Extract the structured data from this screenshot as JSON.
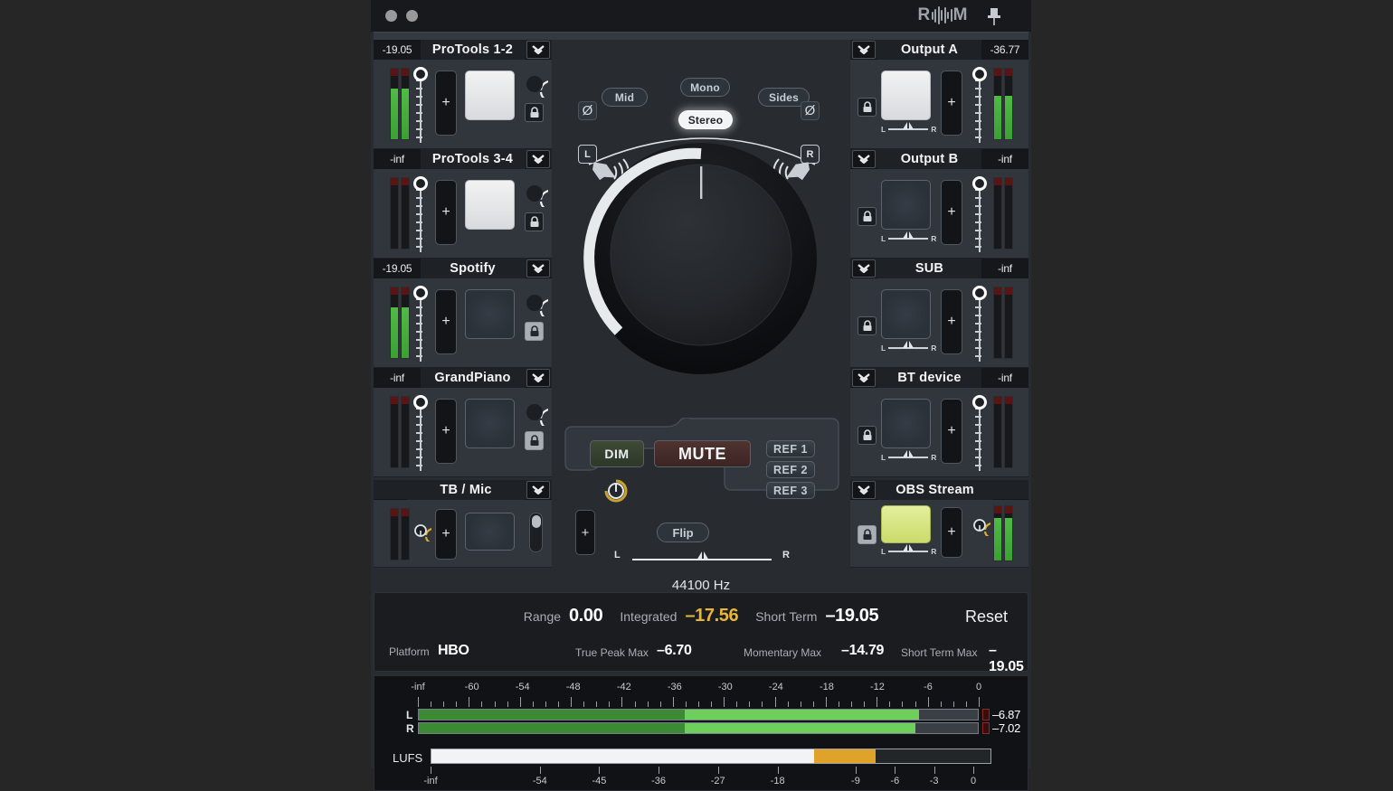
{
  "window": {
    "logo_text_left": "R",
    "logo_text_right": "M",
    "pin_icon": "pushpin-icon",
    "close_dot": "window-dot",
    "min_dot": "window-dot"
  },
  "inputs": [
    {
      "value": "-19.05",
      "name": "ProTools 1-2",
      "meter_pct": 72,
      "pad_state": "lit",
      "fader_pct": 100,
      "lock": "unlocked",
      "plus": "+"
    },
    {
      "value": "-inf",
      "name": "ProTools 3-4",
      "meter_pct": 0,
      "pad_state": "lit",
      "fader_pct": 100,
      "lock": "unlocked",
      "plus": "+"
    },
    {
      "value": "-19.05",
      "name": "Spotify",
      "meter_pct": 72,
      "pad_state": "dark",
      "fader_pct": 100,
      "lock": "locked",
      "plus": "+"
    },
    {
      "value": "-inf",
      "name": "GrandPiano",
      "meter_pct": 0,
      "pad_state": "dark",
      "fader_pct": 100,
      "lock": "locked",
      "plus": "+"
    }
  ],
  "talkback": {
    "name": "TB / Mic",
    "plus": "+",
    "mic_icon": "mic-knob-icon",
    "slider_icon": "vertical-slider"
  },
  "outputs": [
    {
      "name": "Output A",
      "value": "-36.77",
      "meter_pct": 62,
      "pad_state": "lit",
      "lock": "unlocked",
      "plus": "+",
      "pan_l": "L",
      "pan_r": "R"
    },
    {
      "name": "Output B",
      "value": "-inf",
      "meter_pct": 0,
      "pad_state": "dark",
      "lock": "unlocked",
      "plus": "+",
      "pan_l": "L",
      "pan_r": "R"
    },
    {
      "name": "SUB",
      "value": "-inf",
      "meter_pct": 0,
      "pad_state": "dark",
      "lock": "unlocked",
      "plus": "+",
      "pan_l": "L",
      "pan_r": "R"
    },
    {
      "name": "BT device",
      "value": "-inf",
      "meter_pct": 0,
      "pad_state": "dark",
      "lock": "unlocked",
      "plus": "+",
      "pan_l": "L",
      "pan_r": "R"
    }
  ],
  "stream": {
    "name": "OBS Stream",
    "plus": "+",
    "pan_l": "L",
    "pan_r": "R",
    "meter_pct": 78,
    "pad_state": "green",
    "lock": "unlocked",
    "mic_icon": "mic-knob-icon"
  },
  "center": {
    "mid_label": "Mid",
    "mono_label": "Mono",
    "sides_label": "Sides",
    "stereo_label": "Stereo",
    "stereo_active": true,
    "phase_symbol": "Ø",
    "left_label": "L",
    "right_label": "R",
    "volume_knob": "main-volume-knob",
    "dim_label": "DIM",
    "mute_label": "MUTE",
    "ref_labels": [
      "REF 1",
      "REF 2",
      "REF 3"
    ],
    "power_icon": "power-icon",
    "flip_label": "Flip",
    "balance_left": "L",
    "balance_right": "R",
    "sample_rate": "44100 Hz",
    "plus": "+"
  },
  "loudness": {
    "range_label": "Range",
    "range_value": "0.00",
    "integrated_label": "Integrated",
    "integrated_value": "–17.56",
    "short_term_label": "Short Term",
    "short_term_value": "–19.05",
    "reset_label": "Reset",
    "platform_label": "Platform",
    "platform_value": "HBO",
    "true_peak_label": "True Peak Max",
    "true_peak_value": "–6.70",
    "momentary_label": "Momentary Max",
    "momentary_value": "–14.79",
    "short_term_max_label": "Short Term Max",
    "short_term_max_value": "–19.05",
    "accent_yellow": "#e8b63a"
  },
  "chart_data": {
    "type": "bar",
    "title": "Peak / LUFS meters",
    "peak_meter": {
      "scale_labels": [
        "-inf",
        "-60",
        "-54",
        "-48",
        "-42",
        "-36",
        "-30",
        "-24",
        "-18",
        "-12",
        "-6",
        "0"
      ],
      "scale_positions": [
        0,
        11.5,
        22.3,
        33.1,
        43.9,
        54.7,
        65.5,
        76.3,
        87.1,
        97.9,
        108.7,
        119.5
      ],
      "channels": [
        {
          "label": "L",
          "value": -6.87,
          "fill_pct": 89.5,
          "bright_start_pct": 47.5,
          "readout": "–6.87"
        },
        {
          "label": "R",
          "value": -7.02,
          "fill_pct": 88.8,
          "bright_start_pct": 47.5,
          "readout": "–7.02"
        }
      ],
      "color_dark_green": "#3c8a33",
      "color_light_green": "#6ecf5d",
      "clip_color": "#3a0d0d"
    },
    "lufs_meter": {
      "label": "LUFS",
      "scale_labels": [
        "-inf",
        "-54",
        "-45",
        "-36",
        "-27",
        "-18",
        "-9",
        "-6",
        "-3",
        "0"
      ],
      "white_fill_pct": 68.5,
      "orange_fill_start_pct": 68.5,
      "orange_fill_end_pct": 79.5,
      "white_color": "#f2f3f4",
      "orange_color": "#e0a32a"
    }
  }
}
